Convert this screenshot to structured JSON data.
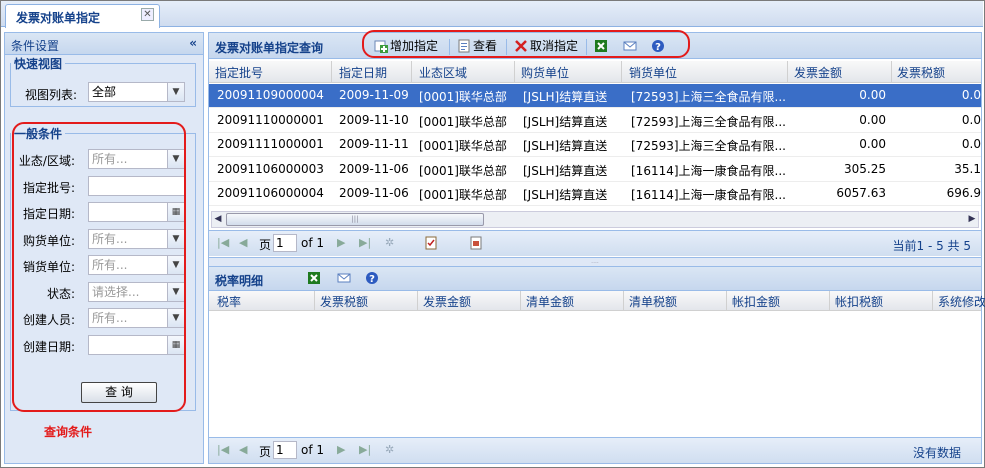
{
  "tab": {
    "label": "发票对账单指定",
    "close": "✕"
  },
  "left": {
    "title": "条件设置",
    "collapse": "«",
    "quick_view": {
      "legend": "快速视图",
      "view_label": "视图列表:",
      "view_value": "全部"
    },
    "general": {
      "legend": "一般条件",
      "fields": [
        {
          "label": "业态/区域:",
          "value": "所有...",
          "type": "combo"
        },
        {
          "label": "指定批号:",
          "value": "",
          "type": "text"
        },
        {
          "label": "指定日期:",
          "value": "",
          "type": "date"
        },
        {
          "label": "购货单位:",
          "value": "所有...",
          "type": "combo"
        },
        {
          "label": "销货单位:",
          "value": "所有...",
          "type": "combo"
        },
        {
          "label": "状态:",
          "value": "请选择...",
          "type": "combo"
        },
        {
          "label": "创建人员:",
          "value": "所有...",
          "type": "combo"
        },
        {
          "label": "创建日期:",
          "value": "",
          "type": "date"
        }
      ],
      "query_button": "查 询"
    },
    "annotation": "查询条件"
  },
  "main": {
    "title": "发票对账单指定查询",
    "toolbar": {
      "add": "增加指定",
      "view": "查看",
      "cancel": "取消指定"
    },
    "columns": [
      "指定批号",
      "指定日期",
      "业态区域",
      "购货单位",
      "销货单位",
      "发票金额",
      "发票税额"
    ],
    "rows": [
      {
        "batch": "20091109000004",
        "date": "2009-11-09",
        "region": "[0001]联华总部",
        "buyer": "[JSLH]结算直送",
        "seller": "[72593]上海三全食品有限...",
        "amount": "0.00",
        "tax": "0.0"
      },
      {
        "batch": "20091110000001",
        "date": "2009-11-10",
        "region": "[0001]联华总部",
        "buyer": "[JSLH]结算直送",
        "seller": "[72593]上海三全食品有限...",
        "amount": "0.00",
        "tax": "0.0"
      },
      {
        "batch": "20091111000001",
        "date": "2009-11-11",
        "region": "[0001]联华总部",
        "buyer": "[JSLH]结算直送",
        "seller": "[72593]上海三全食品有限...",
        "amount": "0.00",
        "tax": "0.0"
      },
      {
        "batch": "20091106000003",
        "date": "2009-11-06",
        "region": "[0001]联华总部",
        "buyer": "[JSLH]结算直送",
        "seller": "[16114]上海一康食品有限...",
        "amount": "305.25",
        "tax": "35.1"
      },
      {
        "batch": "20091106000004",
        "date": "2009-11-06",
        "region": "[0001]联华总部",
        "buyer": "[JSLH]结算直送",
        "seller": "[16114]上海一康食品有限...",
        "amount": "6057.63",
        "tax": "696.9"
      }
    ],
    "pager": {
      "page_label": "页",
      "page": "1",
      "of": "of 1",
      "status": "当前1 - 5 共 5"
    }
  },
  "detail": {
    "title": "税率明细",
    "columns": [
      "税率",
      "发票税额",
      "发票金额",
      "清单金额",
      "清单税额",
      "帐扣金额",
      "帐扣税额",
      "系统修改"
    ],
    "pager": {
      "page_label": "页",
      "page": "1",
      "of": "of 1",
      "status": "没有数据"
    }
  }
}
